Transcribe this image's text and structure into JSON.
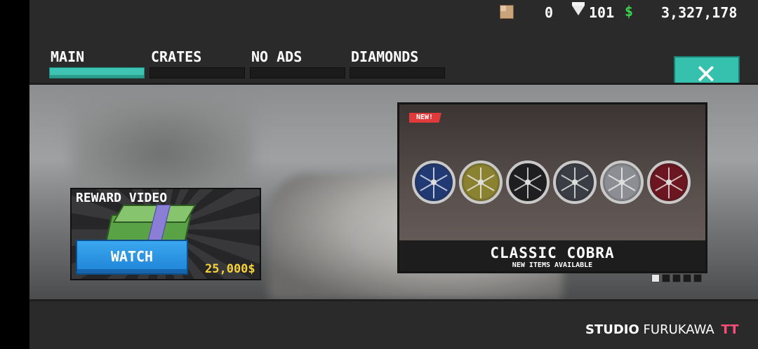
{
  "resources": {
    "crates": "0",
    "diamonds": "101",
    "money_icon": "$",
    "money": "3,327,178"
  },
  "tabs": [
    {
      "label": "MAIN",
      "active": true
    },
    {
      "label": "CRATES",
      "active": false
    },
    {
      "label": "NO ADS",
      "active": false
    },
    {
      "label": "DIAMONDS",
      "active": false
    }
  ],
  "close_button": {
    "icon": "close-icon",
    "glyph": "✕"
  },
  "reward": {
    "title": "REWARD VIDEO",
    "button_label": "WATCH",
    "amount": "25,000$"
  },
  "promo": {
    "badge": "NEW!",
    "title": "CLASSIC COBRA",
    "subtitle": "NEW ITEMS AVAILABLE",
    "wheel_colors": [
      "#223a73",
      "#8a8131",
      "#1e1e20",
      "#3a3d44",
      "#8d8e93",
      "#6b1620"
    ],
    "page_count": 5,
    "active_page": 1
  },
  "brand": {
    "studio": "STUDIO",
    "name": "FURUKAWA",
    "logo": "TT"
  },
  "colors": {
    "accent": "#36c1ae",
    "button_blue": "#1f83d6",
    "money_green": "#3ad24a",
    "gold": "#f6d23c"
  }
}
